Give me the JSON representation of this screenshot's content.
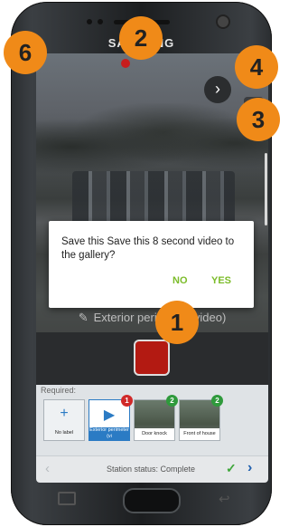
{
  "device": {
    "brand": "SAMSUNG"
  },
  "camera": {
    "caption": "Exterior perimeter (video)",
    "chevron_icon": "chevron-right-icon",
    "flip_icon": "camera-flip-icon",
    "pencil_icon": "pencil-icon"
  },
  "dialog": {
    "message": "Save this Save this 8 second video to the gallery?",
    "no_label": "NO",
    "yes_label": "YES"
  },
  "required": {
    "label": "Required:",
    "items": [
      {
        "label": "No label",
        "icon": "+",
        "badge": ""
      },
      {
        "label": "Exterior perimeter (vi",
        "icon": "▶",
        "badge": "1"
      },
      {
        "label": "Door knock",
        "icon": "",
        "badge": "2"
      },
      {
        "label": "Front of house",
        "icon": "",
        "badge": "2"
      }
    ]
  },
  "status": {
    "text": "Station status: Complete",
    "prev_icon": "‹",
    "next_icon": "›",
    "check_icon": "✓"
  },
  "markers": {
    "m1": "1",
    "m2": "2",
    "m3": "3",
    "m4": "4",
    "m6": "6"
  },
  "colors": {
    "accent_green": "#7cbc2a",
    "record_red": "#b31a12",
    "marker_orange": "#f08a18",
    "link_blue": "#1f5fae"
  }
}
